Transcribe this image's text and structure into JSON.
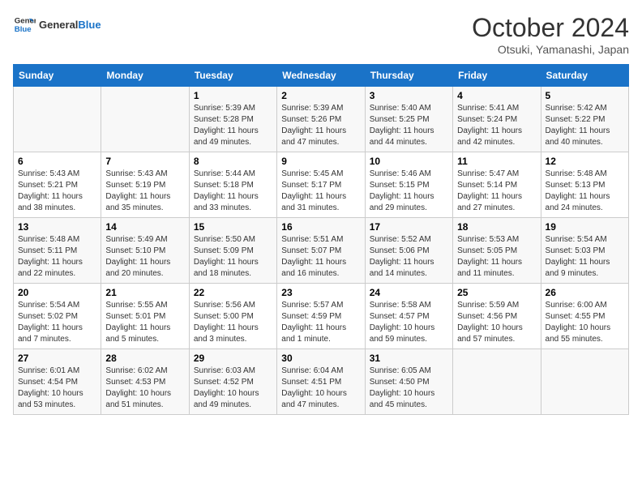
{
  "logo": {
    "text_general": "General",
    "text_blue": "Blue"
  },
  "title": {
    "month_year": "October 2024",
    "location": "Otsuki, Yamanashi, Japan"
  },
  "headers": [
    "Sunday",
    "Monday",
    "Tuesday",
    "Wednesday",
    "Thursday",
    "Friday",
    "Saturday"
  ],
  "weeks": [
    [
      {
        "day": "",
        "info": ""
      },
      {
        "day": "",
        "info": ""
      },
      {
        "day": "1",
        "info": "Sunrise: 5:39 AM\nSunset: 5:28 PM\nDaylight: 11 hours and 49 minutes."
      },
      {
        "day": "2",
        "info": "Sunrise: 5:39 AM\nSunset: 5:26 PM\nDaylight: 11 hours and 47 minutes."
      },
      {
        "day": "3",
        "info": "Sunrise: 5:40 AM\nSunset: 5:25 PM\nDaylight: 11 hours and 44 minutes."
      },
      {
        "day": "4",
        "info": "Sunrise: 5:41 AM\nSunset: 5:24 PM\nDaylight: 11 hours and 42 minutes."
      },
      {
        "day": "5",
        "info": "Sunrise: 5:42 AM\nSunset: 5:22 PM\nDaylight: 11 hours and 40 minutes."
      }
    ],
    [
      {
        "day": "6",
        "info": "Sunrise: 5:43 AM\nSunset: 5:21 PM\nDaylight: 11 hours and 38 minutes."
      },
      {
        "day": "7",
        "info": "Sunrise: 5:43 AM\nSunset: 5:19 PM\nDaylight: 11 hours and 35 minutes."
      },
      {
        "day": "8",
        "info": "Sunrise: 5:44 AM\nSunset: 5:18 PM\nDaylight: 11 hours and 33 minutes."
      },
      {
        "day": "9",
        "info": "Sunrise: 5:45 AM\nSunset: 5:17 PM\nDaylight: 11 hours and 31 minutes."
      },
      {
        "day": "10",
        "info": "Sunrise: 5:46 AM\nSunset: 5:15 PM\nDaylight: 11 hours and 29 minutes."
      },
      {
        "day": "11",
        "info": "Sunrise: 5:47 AM\nSunset: 5:14 PM\nDaylight: 11 hours and 27 minutes."
      },
      {
        "day": "12",
        "info": "Sunrise: 5:48 AM\nSunset: 5:13 PM\nDaylight: 11 hours and 24 minutes."
      }
    ],
    [
      {
        "day": "13",
        "info": "Sunrise: 5:48 AM\nSunset: 5:11 PM\nDaylight: 11 hours and 22 minutes."
      },
      {
        "day": "14",
        "info": "Sunrise: 5:49 AM\nSunset: 5:10 PM\nDaylight: 11 hours and 20 minutes."
      },
      {
        "day": "15",
        "info": "Sunrise: 5:50 AM\nSunset: 5:09 PM\nDaylight: 11 hours and 18 minutes."
      },
      {
        "day": "16",
        "info": "Sunrise: 5:51 AM\nSunset: 5:07 PM\nDaylight: 11 hours and 16 minutes."
      },
      {
        "day": "17",
        "info": "Sunrise: 5:52 AM\nSunset: 5:06 PM\nDaylight: 11 hours and 14 minutes."
      },
      {
        "day": "18",
        "info": "Sunrise: 5:53 AM\nSunset: 5:05 PM\nDaylight: 11 hours and 11 minutes."
      },
      {
        "day": "19",
        "info": "Sunrise: 5:54 AM\nSunset: 5:03 PM\nDaylight: 11 hours and 9 minutes."
      }
    ],
    [
      {
        "day": "20",
        "info": "Sunrise: 5:54 AM\nSunset: 5:02 PM\nDaylight: 11 hours and 7 minutes."
      },
      {
        "day": "21",
        "info": "Sunrise: 5:55 AM\nSunset: 5:01 PM\nDaylight: 11 hours and 5 minutes."
      },
      {
        "day": "22",
        "info": "Sunrise: 5:56 AM\nSunset: 5:00 PM\nDaylight: 11 hours and 3 minutes."
      },
      {
        "day": "23",
        "info": "Sunrise: 5:57 AM\nSunset: 4:59 PM\nDaylight: 11 hours and 1 minute."
      },
      {
        "day": "24",
        "info": "Sunrise: 5:58 AM\nSunset: 4:57 PM\nDaylight: 10 hours and 59 minutes."
      },
      {
        "day": "25",
        "info": "Sunrise: 5:59 AM\nSunset: 4:56 PM\nDaylight: 10 hours and 57 minutes."
      },
      {
        "day": "26",
        "info": "Sunrise: 6:00 AM\nSunset: 4:55 PM\nDaylight: 10 hours and 55 minutes."
      }
    ],
    [
      {
        "day": "27",
        "info": "Sunrise: 6:01 AM\nSunset: 4:54 PM\nDaylight: 10 hours and 53 minutes."
      },
      {
        "day": "28",
        "info": "Sunrise: 6:02 AM\nSunset: 4:53 PM\nDaylight: 10 hours and 51 minutes."
      },
      {
        "day": "29",
        "info": "Sunrise: 6:03 AM\nSunset: 4:52 PM\nDaylight: 10 hours and 49 minutes."
      },
      {
        "day": "30",
        "info": "Sunrise: 6:04 AM\nSunset: 4:51 PM\nDaylight: 10 hours and 47 minutes."
      },
      {
        "day": "31",
        "info": "Sunrise: 6:05 AM\nSunset: 4:50 PM\nDaylight: 10 hours and 45 minutes."
      },
      {
        "day": "",
        "info": ""
      },
      {
        "day": "",
        "info": ""
      }
    ]
  ]
}
